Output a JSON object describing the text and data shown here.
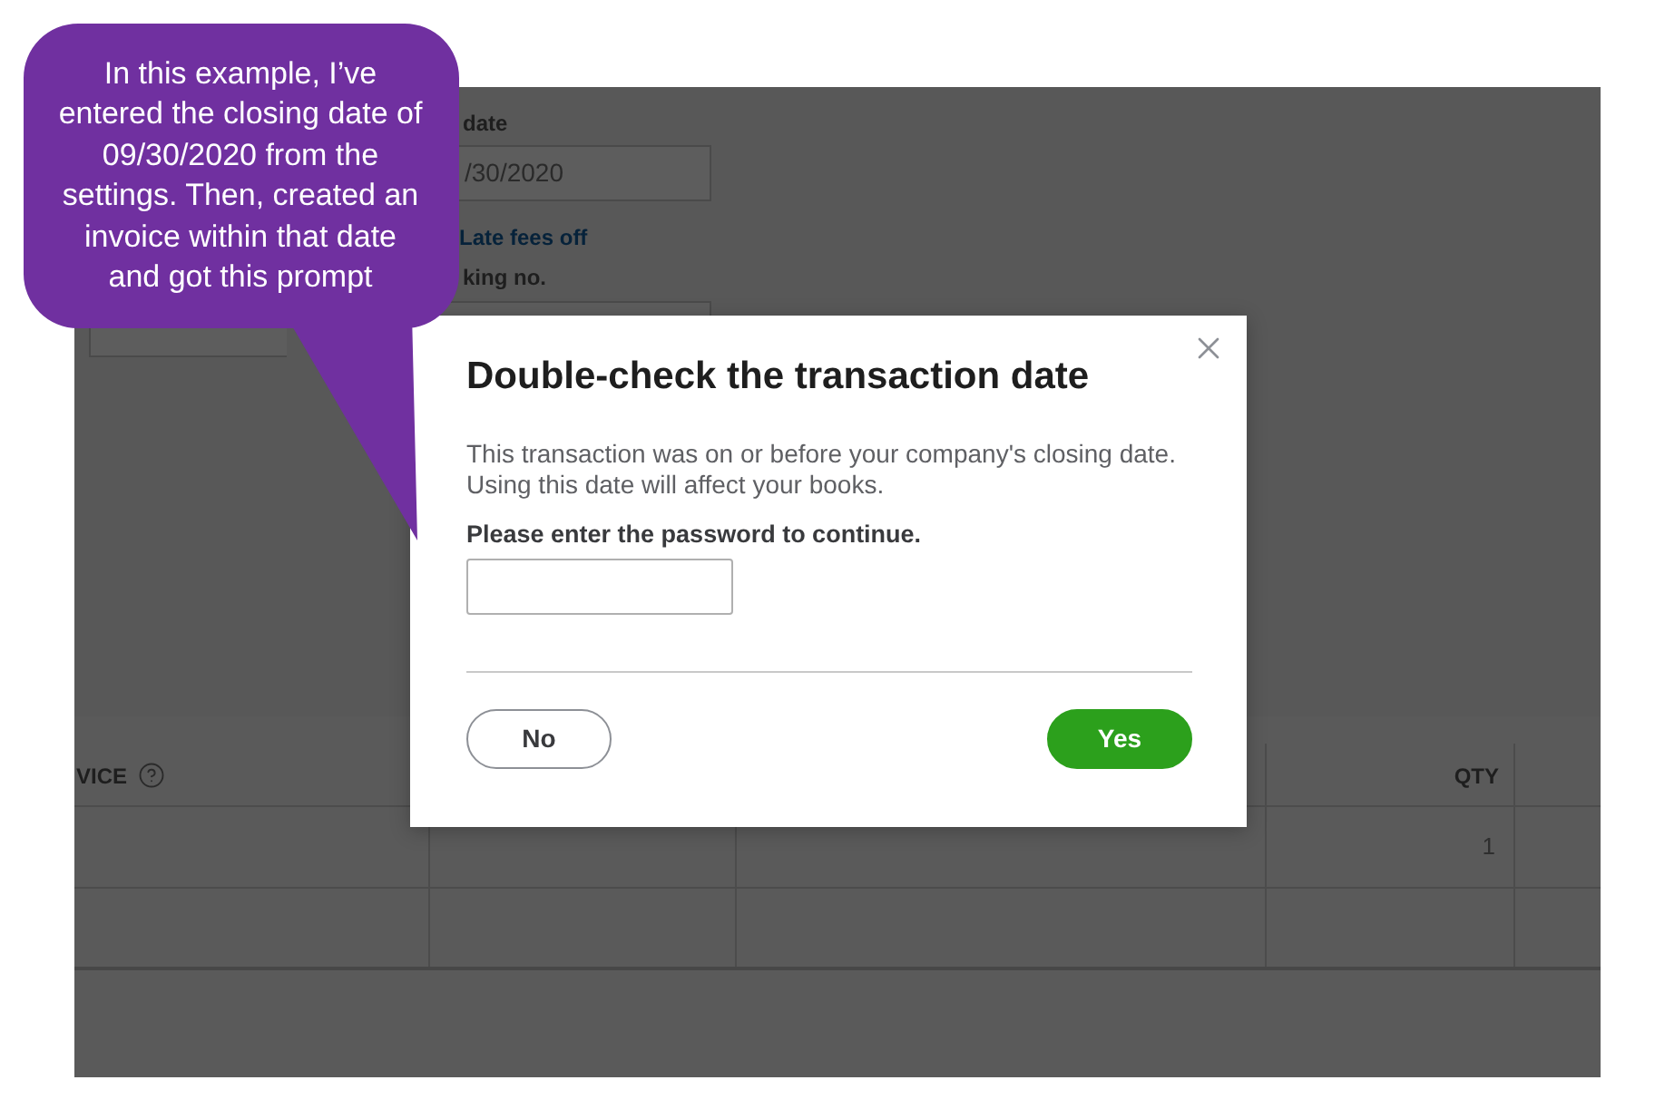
{
  "invoice_form": {
    "date_label": "date",
    "date_value": "/30/2020",
    "late_fees_link": "Late fees off",
    "number_label": "king no."
  },
  "table": {
    "headers": {
      "column_1": "VICE",
      "qty": "QTY"
    },
    "rows": [
      {
        "qty": "1"
      }
    ]
  },
  "dialog": {
    "title": "Double-check the transaction date",
    "message": "This transaction was on or before your company's closing date. Using this date will affect your books.",
    "password_label": "Please enter the password to continue.",
    "buttons": [
      {
        "label": "No",
        "kind": "secondary"
      },
      {
        "label": "Yes",
        "kind": "primary"
      }
    ]
  },
  "callout": {
    "text": "In this example, I’ve entered the closing date of 09/30/2020 from the settings. Then, created an invoice within that date and got this prompt"
  }
}
